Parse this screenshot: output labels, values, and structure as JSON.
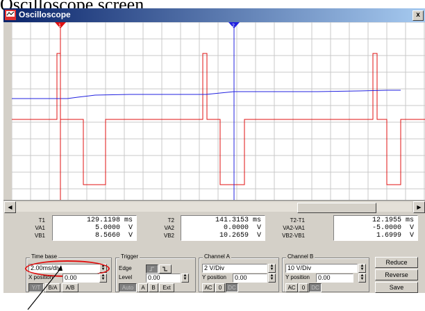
{
  "caption": "Oscilloscope screen.",
  "window": {
    "title": "Oscilloscope",
    "close": "x"
  },
  "readout": {
    "t1": {
      "label": "T1",
      "value": "129.1198 ms"
    },
    "va1": {
      "label": "VA1",
      "value": "5.0000  V"
    },
    "vb1": {
      "label": "VB1",
      "value": "8.5660  V"
    },
    "t2": {
      "label": "T2",
      "value": "141.3153 ms"
    },
    "va2": {
      "label": "VA2",
      "value": "0.0000  V"
    },
    "vb2": {
      "label": "VB2",
      "value": "10.2659  V"
    },
    "dt": {
      "label": "T2-T1",
      "value": "12.1955 ms"
    },
    "dva": {
      "label": "VA2-VA1",
      "value": "-5.0000  V"
    },
    "dvb": {
      "label": "VB2-VB1",
      "value": "1.6999  V"
    }
  },
  "timebase": {
    "title": "Time base",
    "value": "2.00ms/div",
    "xpos_label": "X position",
    "xpos_value": "0.00",
    "modes": [
      "Y/T",
      "B/A",
      "A/B"
    ]
  },
  "trigger": {
    "title": "Trigger",
    "edge_label": "Edge",
    "level_label": "Level",
    "level_value": "0.00",
    "buttons": [
      "Auto",
      "A",
      "B",
      "Ext"
    ]
  },
  "channel_a": {
    "title": "Channel A",
    "value": "2 V/Div",
    "ypos_label": "Y position",
    "ypos_value": "0.00",
    "coupling": [
      "AC",
      "0",
      "DC"
    ]
  },
  "channel_b": {
    "title": "Channel B",
    "value": "10 V/Div",
    "ypos_label": "Y position",
    "ypos_value": "0.00",
    "coupling": [
      "AC",
      "0",
      "DC"
    ]
  },
  "actions": {
    "reduce": "Reduce",
    "reverse": "Reverse",
    "save": "Save"
  },
  "colors": {
    "channel_a": "#e01010",
    "channel_b": "#2020e0",
    "cursor1": "#e01010",
    "cursor2": "#2020e0",
    "highlight": "#e01010"
  },
  "cursors": {
    "t1_label": "1",
    "t2_label": "2"
  }
}
